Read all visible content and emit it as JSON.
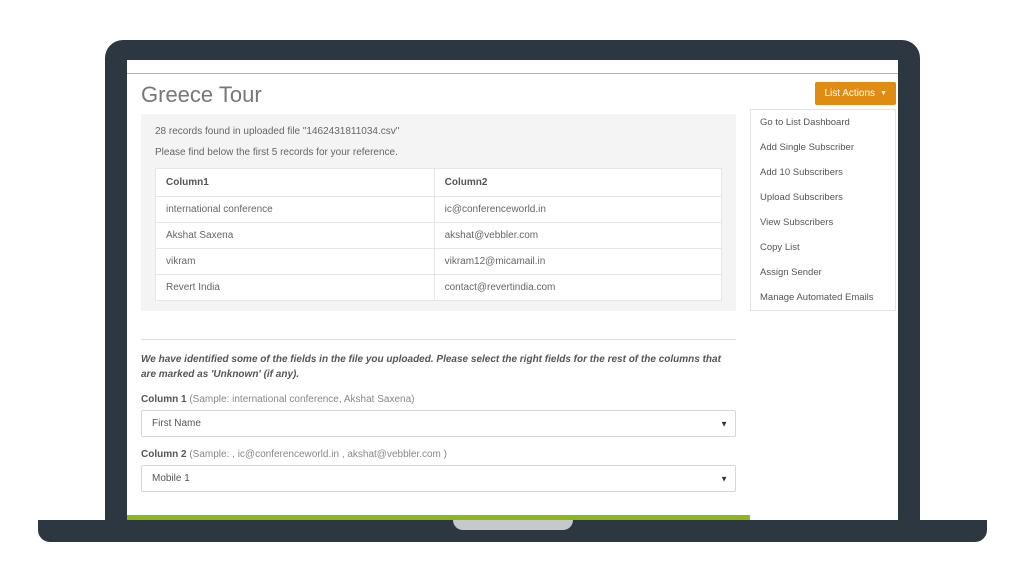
{
  "page_title": "Greece Tour",
  "info": {
    "line1": "28 records found in uploaded file \"1462431811034.csv\"",
    "line2": "Please find below the first 5 records for your reference."
  },
  "preview": {
    "headers": [
      "Column1",
      "Column2"
    ],
    "rows": [
      {
        "c1": "international conference",
        "c2": "ic@conferenceworld.in"
      },
      {
        "c1": "Akshat Saxena",
        "c2": "akshat@vebbler.com"
      },
      {
        "c1": "vikram",
        "c2": "vikram12@micamail.in"
      },
      {
        "c1": "Revert India",
        "c2": "contact@revertindia.com"
      }
    ]
  },
  "identify_note": "We have identified some of the fields in the file you uploaded. Please select the right fields for the rest of the columns that are marked as 'Unknown' (if any).",
  "mapping": {
    "col1": {
      "label": "Column 1",
      "sample": " (Sample: international conference, Akshat Saxena)",
      "value": "First Name"
    },
    "col2": {
      "label": "Column 2",
      "sample": " (Sample: , ic@conferenceworld.in , akshat@vebbler.com )",
      "value": "Mobile 1"
    }
  },
  "actions_button": "List Actions",
  "dropdown": [
    "Go to List Dashboard",
    "Add Single Subscriber",
    "Add 10 Subscribers",
    "Upload Subscribers",
    "View Subscribers",
    "Copy List",
    "Assign Sender",
    "Manage Automated Emails"
  ]
}
